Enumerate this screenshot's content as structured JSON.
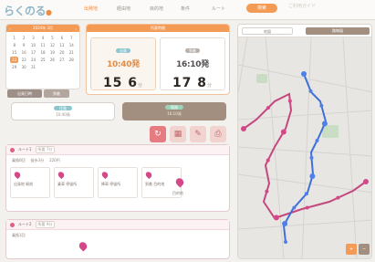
{
  "header": {
    "logo": "らくのる",
    "nav": [
      "出発地",
      "経由地",
      "目的地",
      "条件",
      "ルート"
    ],
    "active_nav_index": 0,
    "primary_button": "検索",
    "note": "ご利用ガイド"
  },
  "calendar": {
    "header_label": "2024年 3月",
    "nav_prev": "‹",
    "nav_next": "›",
    "days": [
      "1",
      "2",
      "3",
      "4",
      "5",
      "6",
      "7",
      "8",
      "9",
      "10",
      "11",
      "12",
      "13",
      "14",
      "15",
      "16",
      "17",
      "18",
      "19",
      "20",
      "21",
      "22",
      "23",
      "24",
      "25",
      "26",
      "27",
      "28",
      "29",
      "30",
      "31"
    ],
    "selected_day": "22",
    "button_left": "出発日時",
    "button_right": "到着"
  },
  "time_panel": {
    "header": "所要時間",
    "cards": [
      {
        "badge": "出発",
        "time": "10:40発",
        "value": "15 6",
        "unit": "分"
      },
      {
        "badge": "到着",
        "time": "16:10発",
        "value": "17 8",
        "unit": "分"
      }
    ]
  },
  "segments": [
    {
      "pill": "往路",
      "sub": "10:40発"
    },
    {
      "pill": "復路",
      "sub": "16:10発"
    }
  ],
  "icon_buttons": [
    {
      "icon": "refresh-icon",
      "glyph": "↻"
    },
    {
      "icon": "calendar-icon",
      "glyph": "▦"
    },
    {
      "icon": "edit-icon",
      "glyph": "✎"
    },
    {
      "icon": "print-icon",
      "glyph": "⎙"
    }
  ],
  "route_list": [
    {
      "title": "ルート1",
      "tag": "所要 7分",
      "row": [
        "乗換0回",
        "徒歩3分",
        "220円"
      ],
      "stops": [
        "出発地 駅前",
        "乗車 停留所",
        "降車 停留所",
        "到着 目的地"
      ],
      "side_label": "目的地"
    },
    {
      "title": "ルート2",
      "tag": "所要 9分",
      "row": [
        "乗換1回"
      ]
    }
  ],
  "map": {
    "tab_left": "地図",
    "tab_right": "路線図",
    "zoom_in": "+",
    "zoom_out": "−",
    "colors": {
      "route_pink": "#c4487f",
      "route_blue": "#3f6fd8",
      "stop_pink": "#d4488a",
      "stop_blue": "#4f7fe8"
    }
  }
}
